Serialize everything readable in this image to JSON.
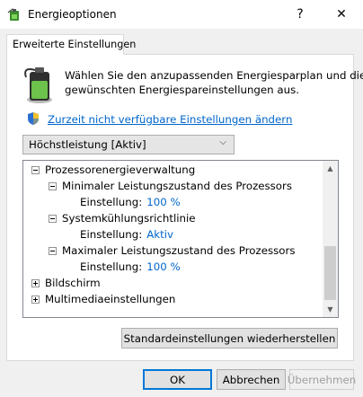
{
  "window": {
    "title": "Energieoptionen",
    "help_label": "?",
    "close_label": "✕"
  },
  "tab": {
    "label": "Erweiterte Einstellungen"
  },
  "description": {
    "line1": "Wählen Sie den anzupassenden Energiesparplan und die",
    "line2": "gewünschten Energiespareinstellungen aus."
  },
  "link": {
    "label": "Zurzeit nicht verfügbare Einstellungen ändern"
  },
  "plan_select": {
    "selected": "Höchstleistung [Aktiv]",
    "chevron": "⌵"
  },
  "tree": {
    "category": "Prozessorenergieverwaltung",
    "items": [
      {
        "label": "Minimaler Leistungszustand des Prozessors",
        "setting_label": "Einstellung:",
        "value": "100 %"
      },
      {
        "label": "Systemkühlungsrichtlinie",
        "setting_label": "Einstellung:",
        "value": "Aktiv"
      },
      {
        "label": "Maximaler Leistungszustand des Prozessors",
        "setting_label": "Einstellung:",
        "value": "100 %"
      }
    ],
    "collapsed": [
      "Bildschirm",
      "Multimediaeinstellungen"
    ],
    "scroll_up": "▲",
    "scroll_down": "▼"
  },
  "buttons": {
    "restore": "Standardeinstellungen wiederherstellen",
    "ok": "OK",
    "cancel": "Abbrechen",
    "apply": "Übernehmen"
  },
  "colors": {
    "link": "#0066cc",
    "accent": "#0078d7"
  },
  "icons": {
    "app": "battery-plug-icon",
    "shield": "uac-shield-icon"
  }
}
